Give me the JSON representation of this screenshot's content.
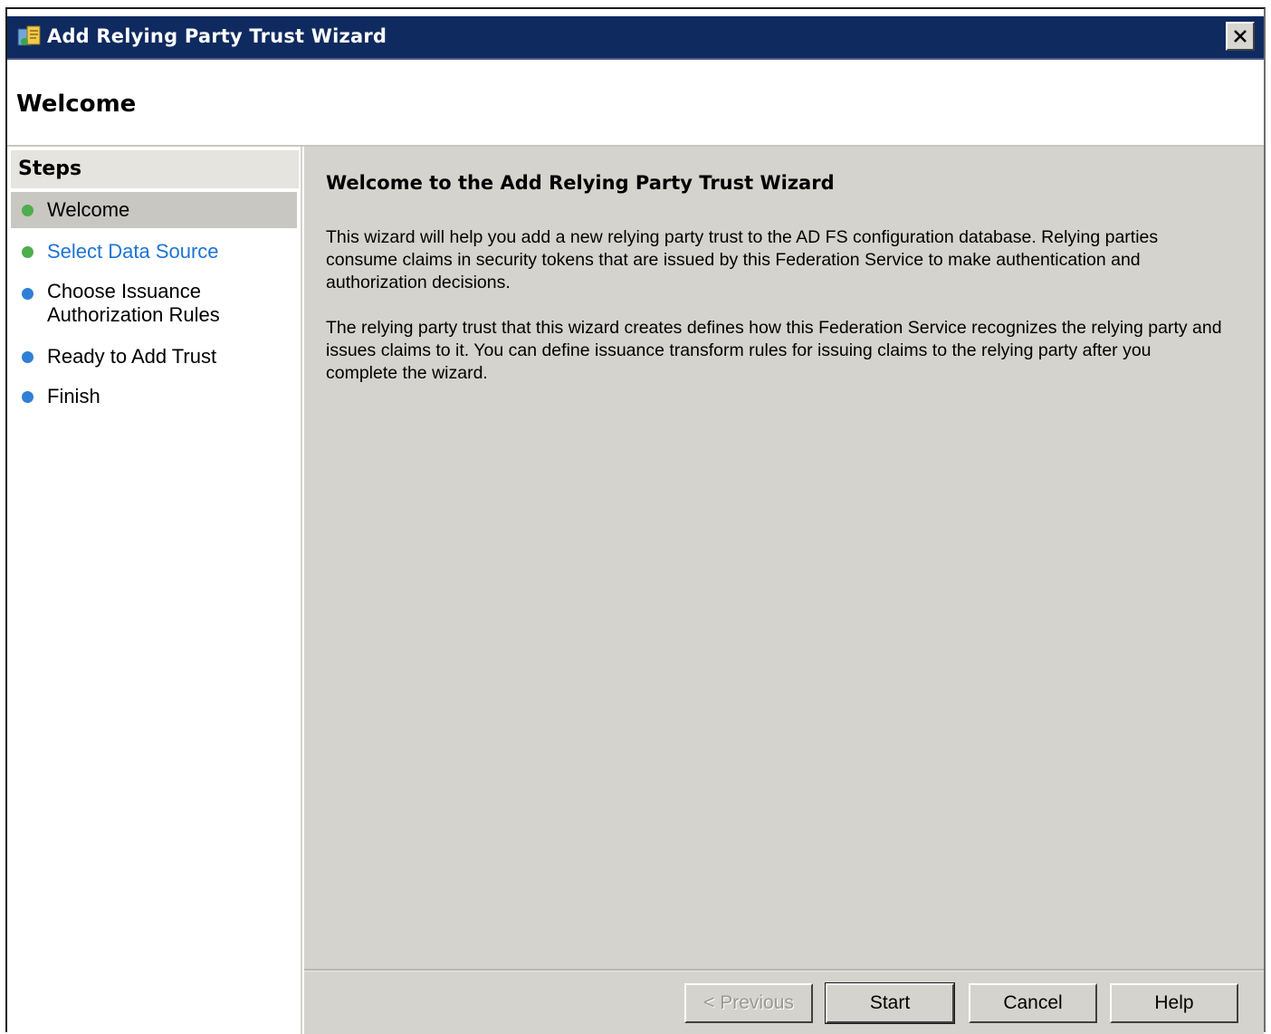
{
  "window": {
    "title": "Add Relying Party Trust Wizard",
    "close_glyph": "×"
  },
  "header": {
    "title": "Welcome"
  },
  "steps": {
    "heading": "Steps",
    "items": [
      {
        "label": "Welcome",
        "state": "current",
        "dot_color": "#4cae4c"
      },
      {
        "label": "Select Data Source",
        "state": "next",
        "dot_color": "#4cae4c"
      },
      {
        "label": "Choose Issuance\nAuthorization Rules",
        "state": "pending",
        "dot_color": "#2f7fd6"
      },
      {
        "label": "Ready to Add Trust",
        "state": "pending",
        "dot_color": "#2f7fd6"
      },
      {
        "label": "Finish",
        "state": "pending",
        "dot_color": "#2f7fd6"
      }
    ]
  },
  "content": {
    "title": "Welcome to the Add Relying Party Trust Wizard",
    "paragraph_1": "This wizard will help you add a new relying party trust to the AD FS configuration database.  Relying parties consume claims in security tokens that are issued by this Federation Service to make authentication and authorization decisions.",
    "paragraph_2": "The relying party trust that this wizard creates defines how this Federation Service recognizes the relying party and issues claims to it. You can define issuance transform rules for issuing claims to the relying party after you complete the wizard."
  },
  "buttons": {
    "previous": "< Previous",
    "start": "Start",
    "cancel": "Cancel",
    "help": "Help"
  },
  "colors": {
    "titlebar": "#0f2a5f",
    "panel": "#d5d3cd",
    "link": "#1c74d6"
  }
}
